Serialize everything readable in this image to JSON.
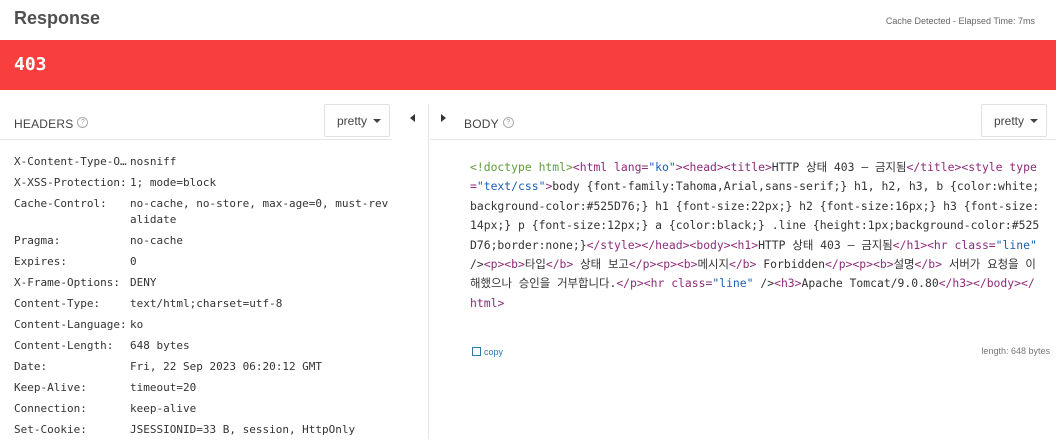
{
  "header": {
    "title": "Response",
    "cache_note": "Cache Detected - Elapsed Time: 7ms"
  },
  "status": {
    "code": "403",
    "color": "#f93e3e"
  },
  "headers_pane": {
    "label": "HEADERS",
    "pretty_label": "pretty",
    "rows": [
      {
        "key": "X-Content-Type-Options:",
        "value": "nosniff"
      },
      {
        "key": "X-XSS-Protection:",
        "value": "1; mode=block"
      },
      {
        "key": "Cache-Control:",
        "value": "no-cache, no-store, max-age=0, must-revalidate"
      },
      {
        "key": "Pragma:",
        "value": "no-cache"
      },
      {
        "key": "Expires:",
        "value": "0"
      },
      {
        "key": "X-Frame-Options:",
        "value": "DENY"
      },
      {
        "key": "Content-Type:",
        "value": "text/html;charset=utf-8"
      },
      {
        "key": "Content-Language:",
        "value": "ko"
      },
      {
        "key": "Content-Length:",
        "value": "648 bytes"
      },
      {
        "key": "Date:",
        "value": "Fri, 22 Sep 2023 06:20:12 GMT"
      },
      {
        "key": "Keep-Alive:",
        "value": "timeout=20"
      },
      {
        "key": "Connection:",
        "value": "keep-alive"
      },
      {
        "key": "Set-Cookie:",
        "value": "JSESSIONID=33 B, session, HttpOnly"
      }
    ]
  },
  "body_pane": {
    "label": "BODY",
    "pretty_label": "pretty",
    "copy_label": "copy",
    "length_note": "length: 648 bytes",
    "code": "<!doctype html><html lang=\"ko\"><head><title>HTTP 상태 403 – 금지됨</title><style type=\"text/css\">body {font-family:Tahoma,Arial,sans-serif;} h1, h2, h3, b {color:white;background-color:#525D76;} h1 {font-size:22px;} h2 {font-size:16px;} h3 {font-size:14px;} p {font-size:12px;} a {color:black;} .line {height:1px;background-color:#525D76;border:none;}</style></head><body><h1>HTTP 상태 403 – 금지됨</h1><hr class=\"line\" /><p><b>타입</b> 상태 보고</p><p><b>메시지</b> Forbidden</p><p><b>설명</b> 서버가 요청을 이해했으나 승인을 거부합니다.</p><hr class=\"line\" /><h3>Apache Tomcat/9.0.80</h3></body></html>"
  },
  "icons": {
    "help": "help-circle-icon",
    "caret": "caret-down-icon",
    "collapse_left": "arrow-left-icon",
    "expand_right": "arrow-right-icon",
    "copy": "copy-icon"
  }
}
